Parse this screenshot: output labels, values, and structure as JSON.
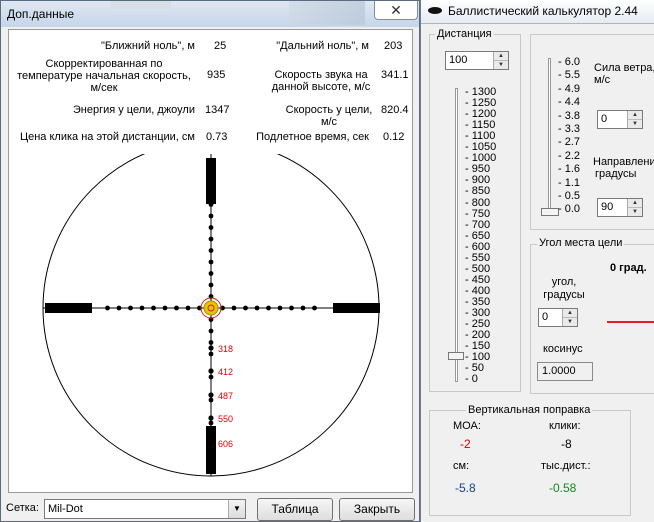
{
  "dialog": {
    "title": "Доп.данные",
    "close_glyph": "✕",
    "params": [
      {
        "label": "\"Ближний ноль\", м",
        "value": "25"
      },
      {
        "label": "\"Дальний ноль\", м",
        "value": "203"
      },
      {
        "label": "Скорректированная по температуре начальная скорость, м/сек",
        "value": "935"
      },
      {
        "label": "Скорость звука на данной высоте, м/с",
        "value": "341.1"
      },
      {
        "label": "Энергия у цели, джоули",
        "value": "1347"
      },
      {
        "label": "Скорость у цели, м/с",
        "value": "820.4"
      },
      {
        "label": "Цена клика на этой дистанции, см",
        "value": "0.73"
      },
      {
        "label": "Подлетное время, сек",
        "value": "0.12"
      }
    ],
    "params_lines": {
      "scv1": "Скорректированная по",
      "scv2": "температуре начальная скорость,",
      "scv3": "м/сек",
      "snd1": "Скорость звука на",
      "snd2": "данной высоте, м/с",
      "spd1": "Скорость у цели,",
      "spd2": "м/с"
    },
    "reticle_marks": [
      "318",
      "412",
      "487",
      "550",
      "606"
    ],
    "reticle_colors": {
      "marks": "#e00000",
      "aim": "#e8c400",
      "ring": "#d22020"
    },
    "grid_label": "Сетка:",
    "grid_value": "Mil-Dot",
    "table_button": "Таблица",
    "close_button": "Закрыть"
  },
  "calc": {
    "title": "Баллистический калькулятор 2.44",
    "distance_group": "Дистанция",
    "distance_value": "100",
    "distance_ticks": [
      "1300",
      "1250",
      "1200",
      "1150",
      "1100",
      "1050",
      "1000",
      "950",
      "900",
      "850",
      "800",
      "750",
      "700",
      "650",
      "600",
      "550",
      "500",
      "450",
      "400",
      "350",
      "300",
      "250",
      "200",
      "150",
      "100",
      "50",
      "0"
    ],
    "wind_ticks": [
      "6.0",
      "5.5",
      "4.9",
      "4.4",
      "3.8",
      "3.3",
      "2.7",
      "2.2",
      "1.6",
      "1.1",
      "0.5",
      "0.0"
    ],
    "wind_speed_label": "Сила ветра, м/с",
    "wind_speed_l1": "Сила ветра,",
    "wind_speed_l2": "м/с",
    "wind_speed_value": "0",
    "wind_dir_l1": "Направлени",
    "wind_dir_l2": "градусы",
    "wind_dir_value": "90",
    "angle_group": "Угол места цели",
    "angle_display": "0 град.",
    "angle_l1": "угол,",
    "angle_l2": "градусы",
    "angle_value": "0",
    "cos_label": "косинус",
    "cos_value": "1.0000",
    "vert_group": "Вертикальная поправка",
    "moa_label": "МОА:",
    "moa_value": "-2",
    "clicks_label": "клики:",
    "clicks_value": "-8",
    "cm_label": "см:",
    "cm_value": "-5.8",
    "thous_label": "тыс.дист.:",
    "thous_value": "-0.58",
    "colors": {
      "moa": "#d00000",
      "cm": "#1a3f8a",
      "thous": "#118a22",
      "angle_line": "#e02020"
    }
  }
}
